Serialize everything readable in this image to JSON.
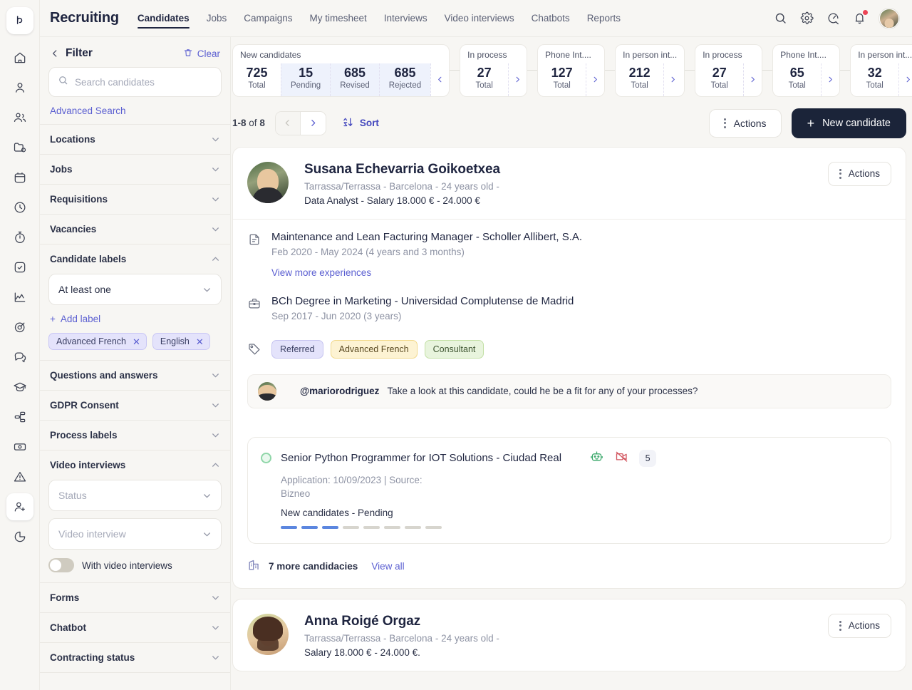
{
  "app": {
    "brand": "Recruiting",
    "logo_icon": "bizneo-logo-icon"
  },
  "nav": {
    "items": [
      {
        "label": "Candidates",
        "active": true
      },
      {
        "label": "Jobs",
        "active": false
      },
      {
        "label": "Campaigns",
        "active": false
      },
      {
        "label": "My timesheet",
        "active": false
      },
      {
        "label": "Interviews",
        "active": false
      },
      {
        "label": "Video interviews",
        "active": false
      },
      {
        "label": "Chatbots",
        "active": false
      },
      {
        "label": "Reports",
        "active": false
      }
    ],
    "top_icons": [
      "search-icon",
      "gear-icon",
      "speedometer-icon",
      "bell-icon"
    ],
    "avatar": "user-avatar"
  },
  "rail": {
    "items": [
      {
        "icon": "home-icon",
        "active": false
      },
      {
        "icon": "user-icon",
        "active": false
      },
      {
        "icon": "users-icon",
        "active": false
      },
      {
        "icon": "folder-icon",
        "active": false
      },
      {
        "icon": "calendar-icon",
        "active": false
      },
      {
        "icon": "clock-icon",
        "active": false
      },
      {
        "icon": "stopwatch-icon",
        "active": false
      },
      {
        "icon": "check-square-icon",
        "active": false
      },
      {
        "icon": "chart-line-icon",
        "active": false
      },
      {
        "icon": "target-icon",
        "active": false
      },
      {
        "icon": "chat-icon",
        "active": false
      },
      {
        "icon": "graduation-cap-icon",
        "active": false
      },
      {
        "icon": "workflow-icon",
        "active": false
      },
      {
        "icon": "money-icon",
        "active": false
      },
      {
        "icon": "alert-icon",
        "active": false
      },
      {
        "icon": "user-plus-icon",
        "active": true
      },
      {
        "icon": "pie-chart-icon",
        "active": false
      }
    ]
  },
  "filter": {
    "title": "Filter",
    "back_icon": "chevron-left-icon",
    "clear_label": "Clear",
    "clear_icon": "trash-icon",
    "search_placeholder": "Search candidates",
    "search_value": "",
    "advanced_search": "Advanced Search",
    "sections": [
      {
        "label": "Locations",
        "expanded": false
      },
      {
        "label": "Jobs",
        "expanded": false
      },
      {
        "label": "Requisitions",
        "expanded": false
      },
      {
        "label": "Vacancies",
        "expanded": false
      },
      {
        "label": "Candidate labels",
        "expanded": true
      },
      {
        "label": "Questions and answers",
        "expanded": false
      },
      {
        "label": "GDPR Consent",
        "expanded": false
      },
      {
        "label": "Process labels",
        "expanded": false
      },
      {
        "label": "Video interviews",
        "expanded": true
      },
      {
        "label": "Forms",
        "expanded": false
      },
      {
        "label": "Chatbot",
        "expanded": false
      },
      {
        "label": "Contracting status",
        "expanded": false
      }
    ],
    "candidate_labels": {
      "match_mode": "At least one",
      "add_label": "Add label",
      "chips": [
        "Advanced French",
        "English"
      ]
    },
    "video_interviews": {
      "status_placeholder": "Status",
      "interview_placeholder": "Video interview",
      "toggle_label": "With video interviews",
      "toggle_on": false
    }
  },
  "stats": {
    "prev_icon": "chevron-left-icon",
    "next_icon": "chevron-right-icon",
    "cards": [
      {
        "title": "New candidates",
        "cells": [
          {
            "value": "725",
            "label": "Total",
            "tint": false
          },
          {
            "value": "15",
            "label": "Pending",
            "tint": true
          },
          {
            "value": "685",
            "label": "Revised",
            "tint": true
          },
          {
            "value": "685",
            "label": "Rejected",
            "tint": true
          }
        ],
        "arrow": "prev"
      },
      {
        "title": "In process",
        "cells": [
          {
            "value": "27",
            "label": "Total",
            "tint": false
          }
        ],
        "arrow": "next"
      },
      {
        "title": "Phone Int....",
        "cells": [
          {
            "value": "127",
            "label": "Total",
            "tint": false
          }
        ],
        "arrow": "next"
      },
      {
        "title": "In person int...",
        "cells": [
          {
            "value": "212",
            "label": "Total",
            "tint": false
          }
        ],
        "arrow": "next"
      },
      {
        "title": "In process",
        "cells": [
          {
            "value": "27",
            "label": "Total",
            "tint": false
          }
        ],
        "arrow": "next"
      },
      {
        "title": "Phone Int....",
        "cells": [
          {
            "value": "65",
            "label": "Total",
            "tint": false
          }
        ],
        "arrow": "next"
      },
      {
        "title": "In person int...",
        "cells": [
          {
            "value": "32",
            "label": "Total",
            "tint": false
          }
        ],
        "arrow": "next"
      }
    ]
  },
  "toolbar": {
    "range": "1-8",
    "of": "of",
    "total": "8",
    "prev_icon": "chevron-left-icon",
    "next_icon": "chevron-right-icon",
    "sort_label": "Sort",
    "sort_icon": "sort-az-icon",
    "actions_label": "Actions",
    "new_candidate_label": "New candidate"
  },
  "candidates": [
    {
      "name": "Susana Echevarria Goikoetxea",
      "meta": "Tarrassa/Terrassa - Barcelona - 24 years old -",
      "role": "Data Analyst - Salary 18.000 € - 24.000 €",
      "actions_label": "Actions",
      "experience": {
        "title": "Maintenance and Lean Facturing Manager - Scholler Allibert, S.A.",
        "dates": "Feb 2020 - May 2024 (4 years and 3 months)",
        "icon": "document-icon"
      },
      "view_more": "View more experiences",
      "education": {
        "title": "BCh Degree in Marketing - Universidad Complutense de Madrid",
        "dates": "Sep 2017 - Jun 2020 (3 years)",
        "icon": "briefcase-icon"
      },
      "tags_icon": "tag-icon",
      "tags": [
        {
          "label": "Referred",
          "color": "purple"
        },
        {
          "label": "Advanced French",
          "color": "yellow"
        },
        {
          "label": "Consultant",
          "color": "green"
        }
      ],
      "comment": {
        "mention": "@mariorodriguez",
        "text": "Take a look at this candidate, could he be a fit for any of your processes?"
      },
      "process": {
        "title": "Senior Python Programmer for IOT Solutions - Ciudad Real",
        "subtitle": "Application: 10/09/2023 | Source: Bizneo",
        "status": "New candidates - Pending",
        "bot_icon": "robot-icon",
        "video_off_icon": "video-off-icon",
        "count": "5",
        "steps_total": 8,
        "steps_done": 3
      },
      "more_candidacies": "7 more candidacies",
      "more_icon": "building-icon",
      "view_all": "View all"
    },
    {
      "name": "Anna Roigé Orgaz",
      "meta": "Tarrassa/Terrassa - Barcelona - 24 years old -",
      "role": "Salary 18.000 € - 24.000 €.",
      "actions_label": "Actions"
    }
  ],
  "colors": {
    "accent": "#5b5fd1",
    "primary_button": "#1b2439",
    "page_bg": "#f7f6f3",
    "card_bg": "#ffffff",
    "step_done": "#5b86df",
    "bot_green": "#3aa86a",
    "video_red": "#d2555f",
    "badge_red": "#ec4455"
  }
}
